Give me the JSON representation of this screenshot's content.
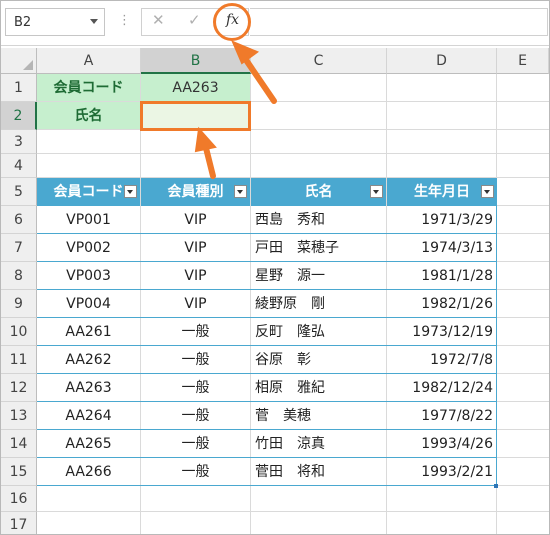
{
  "formula_bar": {
    "name_box": "B2",
    "cancel_icon": "✕",
    "enter_icon": "✓",
    "function_icon": "fx",
    "formula": ""
  },
  "columns": [
    "A",
    "B",
    "C",
    "D",
    "E"
  ],
  "rows": [
    "1",
    "2",
    "3",
    "4",
    "5",
    "6",
    "7",
    "8",
    "9",
    "10",
    "11",
    "12",
    "13",
    "14",
    "15",
    "16",
    "17"
  ],
  "lookup": {
    "member_code_label": "会員コード",
    "member_code_value": "AA263",
    "name_label": "氏名",
    "name_value": ""
  },
  "table": {
    "headers": [
      "会員コード",
      "会員種別",
      "氏名",
      "生年月日"
    ],
    "rows": [
      [
        "VP001",
        "VIP",
        "西島　秀和",
        "1971/3/29"
      ],
      [
        "VP002",
        "VIP",
        "戸田　菜穂子",
        "1974/3/13"
      ],
      [
        "VP003",
        "VIP",
        "星野　源一",
        "1981/1/28"
      ],
      [
        "VP004",
        "VIP",
        "綾野原　剛",
        "1982/1/26"
      ],
      [
        "AA261",
        "一般",
        "反町　隆弘",
        "1973/12/19"
      ],
      [
        "AA262",
        "一般",
        "谷原　彰",
        "1972/7/8"
      ],
      [
        "AA263",
        "一般",
        "相原　雅紀",
        "1982/12/24"
      ],
      [
        "AA264",
        "一般",
        "菅　美穂",
        "1977/8/22"
      ],
      [
        "AA265",
        "一般",
        "竹田　涼真",
        "1993/4/26"
      ],
      [
        "AA266",
        "一般",
        "菅田　将和",
        "1993/2/21"
      ]
    ]
  },
  "colors": {
    "accent": "#f07a2a",
    "table_header": "#4aa8d0",
    "lookup_fill": "#c6efce",
    "selected_header_text": "#217346"
  }
}
